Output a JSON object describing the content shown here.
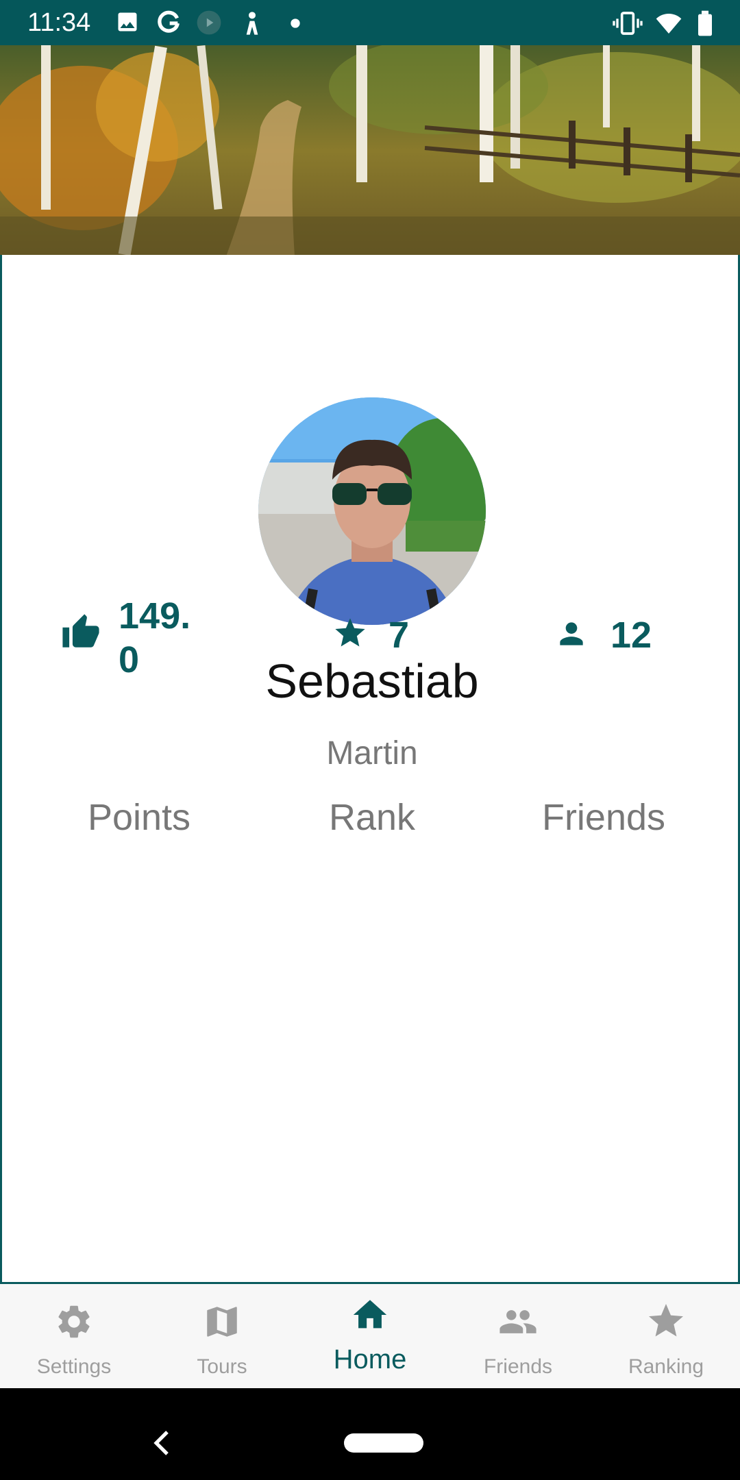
{
  "status_bar": {
    "time": "11:34",
    "icons": [
      "image-icon",
      "google-icon",
      "play-icon",
      "person-icon",
      "dot-icon",
      "vibrate-icon",
      "wifi-icon",
      "battery-icon"
    ]
  },
  "profile": {
    "first_name": "Sebastiab",
    "last_name": "Martin"
  },
  "stats": [
    {
      "label": "Points",
      "value_line1": "149.",
      "value_line2": "0",
      "icon": "thumbs-up-icon"
    },
    {
      "label": "Rank",
      "value": "7",
      "icon": "star-icon"
    },
    {
      "label": "Friends",
      "value": "12",
      "icon": "person-icon"
    }
  ],
  "bottom_nav": [
    {
      "label": "Settings",
      "icon": "gear-icon",
      "active": false
    },
    {
      "label": "Tours",
      "icon": "map-icon",
      "active": false
    },
    {
      "label": "Home",
      "icon": "home-icon",
      "active": true
    },
    {
      "label": "Friends",
      "icon": "people-icon",
      "active": false
    },
    {
      "label": "Ranking",
      "icon": "star-icon",
      "active": false
    }
  ],
  "colors": {
    "primary": "#0a5b5e",
    "status_bar": "#05575a",
    "inactive": "#9e9e9e"
  }
}
